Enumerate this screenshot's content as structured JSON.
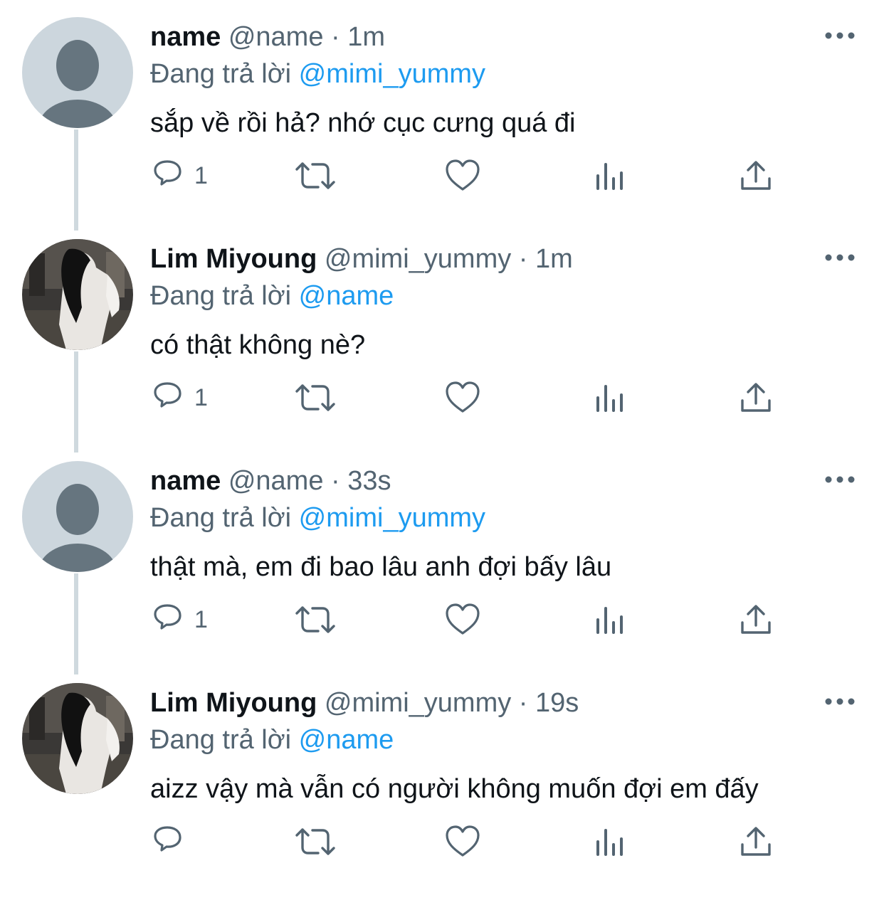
{
  "thread": {
    "tweets": [
      {
        "author_name": "name",
        "handle": "@name",
        "separator": "·",
        "time": "1m",
        "reply_prefix": "Đang trả lời",
        "reply_to": "@mimi_yummy",
        "text": "sắp về rồi hả? nhớ cục cưng quá đi",
        "reply_count": "1",
        "avatar": "default-avatar"
      },
      {
        "author_name": "Lim Miyoung",
        "handle": "@mimi_yummy",
        "separator": "·",
        "time": "1m",
        "reply_prefix": "Đang trả lời",
        "reply_to": "@name",
        "text": "có thật không nè?",
        "reply_count": "1",
        "avatar": "photo-avatar"
      },
      {
        "author_name": "name",
        "handle": "@name",
        "separator": "·",
        "time": "33s",
        "reply_prefix": "Đang trả lời",
        "reply_to": "@mimi_yummy",
        "text": "thật mà, em đi bao lâu anh đợi bấy lâu",
        "reply_count": "1",
        "avatar": "default-avatar"
      },
      {
        "author_name": "Lim Miyoung",
        "handle": "@mimi_yummy",
        "separator": "·",
        "time": "19s",
        "reply_prefix": "Đang trả lời",
        "reply_to": "@name",
        "text": "aizz vậy mà vẫn có người không muốn đợi em đấy",
        "reply_count": "",
        "avatar": "photo-avatar"
      }
    ]
  },
  "icons": {
    "reply": "reply-icon",
    "retweet": "retweet-icon",
    "like": "like-icon",
    "views": "views-icon",
    "share": "share-icon",
    "more": "more-icon"
  },
  "colors": {
    "text": "#0f1419",
    "secondary": "#536471",
    "mention": "#1d9bf0",
    "thread_line": "#cfd9de",
    "default_avatar_bg": "#ccd6dd",
    "default_avatar_fg": "#66757f"
  }
}
